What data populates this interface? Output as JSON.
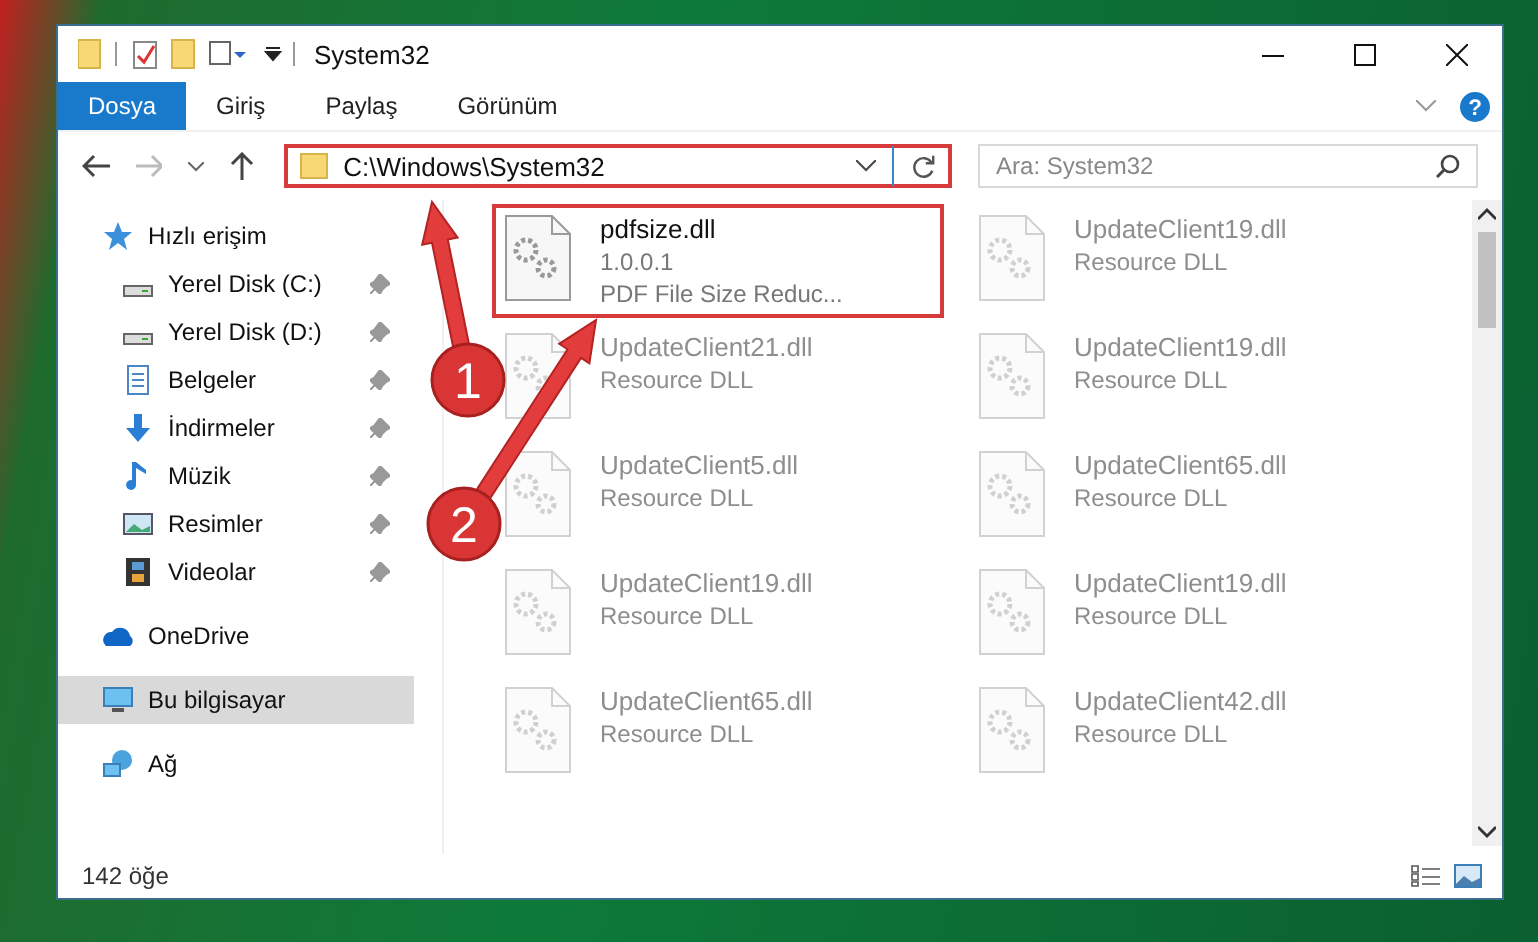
{
  "window": {
    "title": "System32"
  },
  "ribbon_tabs": [
    {
      "label": "Dosya",
      "selected": true
    },
    {
      "label": "Giriş",
      "selected": false
    },
    {
      "label": "Paylaş",
      "selected": false
    },
    {
      "label": "Görünüm",
      "selected": false
    }
  ],
  "address_bar": {
    "path": "C:\\Windows\\System32",
    "highlighted": true
  },
  "help": {
    "label": "?"
  },
  "search": {
    "placeholder": "Ara: System32"
  },
  "sidebar": {
    "items": [
      {
        "label": "Hızlı erişim",
        "kind": "star",
        "selected": false,
        "children": [
          {
            "label": "Yerel Disk (C:)",
            "kind": "drive",
            "pinned": true,
            "selected": false
          },
          {
            "label": "Yerel Disk (D:)",
            "kind": "drive",
            "pinned": true,
            "selected": false
          },
          {
            "label": "Belgeler",
            "kind": "document",
            "pinned": true,
            "selected": false
          },
          {
            "label": "İndirmeler",
            "kind": "download",
            "pinned": true,
            "selected": false
          },
          {
            "label": "Müzik",
            "kind": "music",
            "pinned": true,
            "selected": false
          },
          {
            "label": "Resimler",
            "kind": "picture",
            "pinned": true,
            "selected": false
          },
          {
            "label": "Videolar",
            "kind": "video",
            "pinned": true,
            "selected": false
          }
        ]
      },
      {
        "label": "OneDrive",
        "kind": "cloud",
        "selected": false
      },
      {
        "label": "Bu bilgisayar",
        "kind": "computer",
        "selected": true
      },
      {
        "label": "Ağ",
        "kind": "network",
        "selected": false
      }
    ]
  },
  "files": [
    {
      "name": "pdfsize.dll",
      "details": [
        "1.0.0.1",
        "PDF File Size Reduc..."
      ],
      "highlighted": true,
      "faded": false
    },
    {
      "name": "UpdateClient19.dll",
      "details": [
        "Resource DLL"
      ],
      "highlighted": false,
      "faded": true
    },
    {
      "name": "UpdateClient21.dll",
      "details": [
        "Resource DLL"
      ],
      "highlighted": false,
      "faded": true
    },
    {
      "name": "UpdateClient19.dll",
      "details": [
        "Resource DLL"
      ],
      "highlighted": false,
      "faded": true
    },
    {
      "name": "UpdateClient5.dll",
      "details": [
        "Resource DLL"
      ],
      "highlighted": false,
      "faded": true
    },
    {
      "name": "UpdateClient65.dll",
      "details": [
        "Resource DLL"
      ],
      "highlighted": false,
      "faded": true
    },
    {
      "name": "UpdateClient19.dll",
      "details": [
        "Resource DLL"
      ],
      "highlighted": false,
      "faded": true
    },
    {
      "name": "UpdateClient19.dll",
      "details": [
        "Resource DLL"
      ],
      "highlighted": false,
      "faded": true
    },
    {
      "name": "UpdateClient65.dll",
      "details": [
        "Resource DLL"
      ],
      "highlighted": false,
      "faded": true
    },
    {
      "name": "UpdateClient42.dll",
      "details": [
        "Resource DLL"
      ],
      "highlighted": false,
      "faded": true
    }
  ],
  "status_bar": {
    "count": "142 öğe"
  },
  "callouts": [
    {
      "number": "1"
    },
    {
      "number": "2"
    }
  ]
}
